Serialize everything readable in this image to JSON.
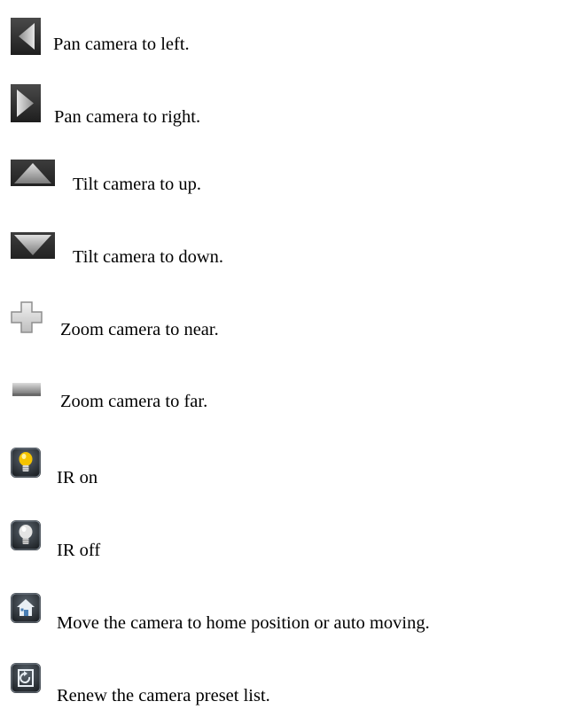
{
  "legend": {
    "items": [
      {
        "icon": "pan-left-icon",
        "label": "Pan camera to left."
      },
      {
        "icon": "pan-right-icon",
        "label": "Pan camera to right."
      },
      {
        "icon": "tilt-up-icon",
        "label": "Tilt camera to up."
      },
      {
        "icon": "tilt-down-icon",
        "label": "Tilt camera to down."
      },
      {
        "icon": "zoom-in-plus-icon",
        "label": "Zoom camera to near."
      },
      {
        "icon": "zoom-out-minus-icon",
        "label": "Zoom camera to far."
      },
      {
        "icon": "ir-on-bulb-icon",
        "label": "IR on"
      },
      {
        "icon": "ir-off-bulb-icon",
        "label": "IR off"
      },
      {
        "icon": "home-icon",
        "label": "Move the camera to home position or auto moving."
      },
      {
        "icon": "renew-list-icon",
        "label": "Renew the camera preset list."
      }
    ]
  },
  "colors": {
    "icon_dark": "#2a2a2a",
    "icon_gray": "#8a8a8a",
    "bulb_on": "#f5c400",
    "bulb_off": "#d9d9d9",
    "text": "#000000"
  }
}
